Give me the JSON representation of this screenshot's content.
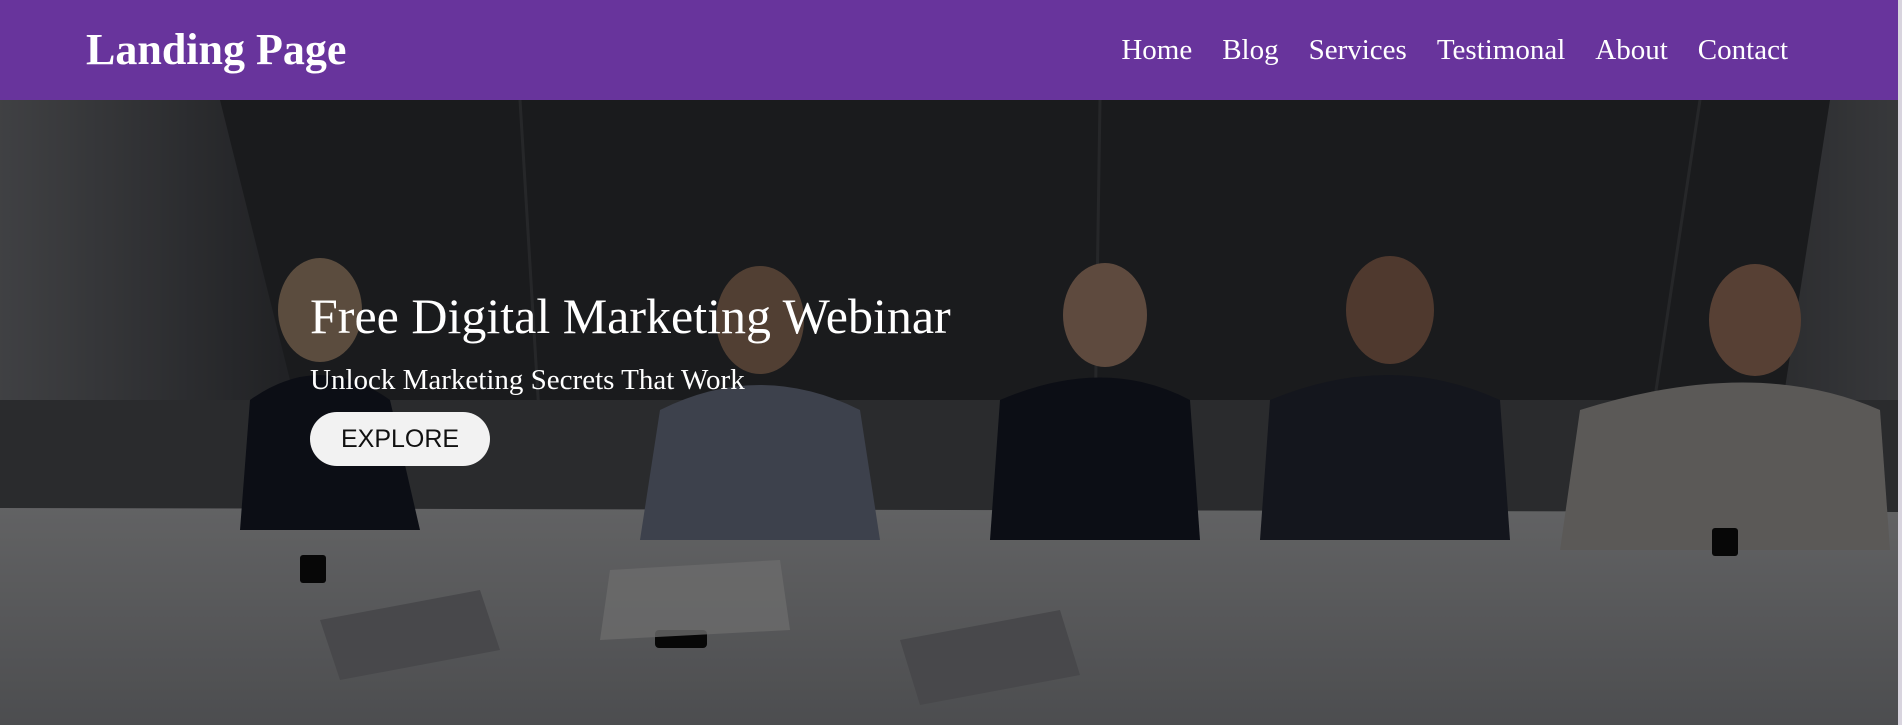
{
  "header": {
    "logo": "Landing Page",
    "nav": [
      {
        "label": "Home"
      },
      {
        "label": "Blog"
      },
      {
        "label": "Services"
      },
      {
        "label": "Testimonal"
      },
      {
        "label": "About"
      },
      {
        "label": "Contact"
      }
    ]
  },
  "hero": {
    "title": "Free Digital Marketing Webinar",
    "subtitle": "Unlock Marketing Secrets That Work",
    "cta_label": "EXPLORE"
  },
  "colors": {
    "header_bg": "#68349c",
    "button_bg": "#f2f2f2"
  }
}
